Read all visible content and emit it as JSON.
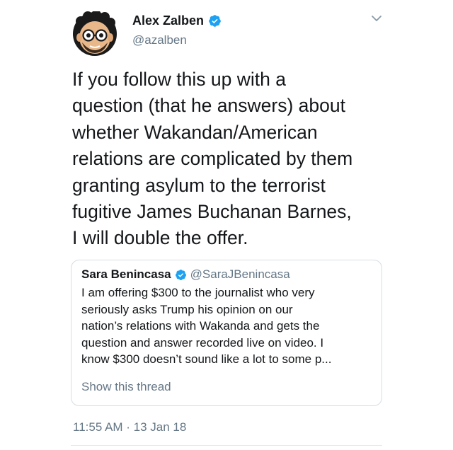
{
  "author": {
    "display_name": "Alex Zalben",
    "handle": "@azalben",
    "verified": true,
    "avatar_icon": "cartoon-face-with-glasses-icon"
  },
  "tweet": {
    "text": "If you follow this up with a\nquestion (that he answers) about\nwhether Wakandan/American\nrelations are complicated by them\ngranting asylum to the terrorist\nfugitive James Buchanan Barnes,\nI will double the offer.",
    "timestamp": "11:55 AM · 13 Jan 18"
  },
  "quoted_tweet": {
    "display_name": "Sara Benincasa",
    "handle": "@SaraJBenincasa",
    "verified": true,
    "text": "I am offering $300 to the journalist who very\nseriously asks Trump his opinion on our\nnation’s relations with Wakanda and gets the\nquestion and answer recorded live on video. I\nknow $300 doesn’t sound like a lot to some p...",
    "show_thread_label": "Show this thread"
  },
  "colors": {
    "text_primary": "#14171a",
    "text_secondary": "#657786",
    "verified_blue": "#1da1f2",
    "border": "#d6dde3"
  }
}
